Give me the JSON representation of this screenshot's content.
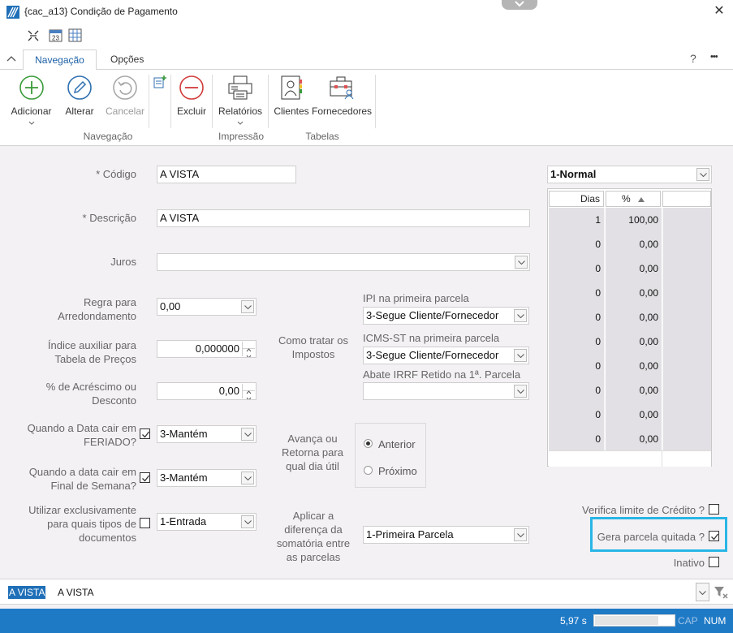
{
  "window": {
    "title": "{cac_a13}  Condição de Pagamento",
    "close_glyph": "✕"
  },
  "tabs": [
    {
      "label": "Navegação",
      "active": true
    },
    {
      "label": "Opções",
      "active": false
    }
  ],
  "tab_right": {
    "help": "?",
    "more": "•••"
  },
  "ribbon": {
    "buttons": {
      "adicionar": "Adicionar",
      "alterar": "Alterar",
      "cancelar": "Cancelar",
      "excluir": "Excluir",
      "relatorios": "Relatórios",
      "clientes": "Clientes",
      "fornecedores": "Fornecedores"
    },
    "groups": {
      "navegacao": "Navegação",
      "impressao": "Impressão",
      "tabelas": "Tabelas"
    }
  },
  "form": {
    "codigo": {
      "label": "* Código",
      "value": "A VISTA"
    },
    "descricao": {
      "label": "* Descrição",
      "value": "A VISTA"
    },
    "juros": {
      "label": "Juros",
      "value": ""
    },
    "regra": {
      "label": "Regra para\nArredondamento",
      "value": "0,00"
    },
    "indice": {
      "label": "Índice auxiliar para\nTabela de Preços",
      "value": "0,000000"
    },
    "acrescimo": {
      "label": "% de Acréscimo ou\nDesconto",
      "value": "0,00"
    },
    "feriado": {
      "label": "Quando a Data cair em\nFERIADO?",
      "checked": true,
      "value": "3-Mantém"
    },
    "fim_semana": {
      "label": "Quando a data cair em\nFinal de Semana?",
      "checked": true,
      "value": "3-Mantém"
    },
    "tipos_doc": {
      "label": "Utilizar exclusivamente\npara quais tipos de\ndocumentos",
      "checked": false,
      "value": "1-Entrada"
    },
    "impostos": {
      "label": "Como tratar os\nImpostos"
    },
    "ipi": {
      "label": "IPI na primeira parcela",
      "value": "3-Segue Cliente/Fornecedor"
    },
    "icms": {
      "label": "ICMS-ST na primeira parcela",
      "value": "3-Segue Cliente/Fornecedor"
    },
    "irrf": {
      "label": "Abate IRRF Retido na 1ª. Parcela",
      "value": ""
    },
    "avanca": {
      "label": "Avança ou\nRetorna para\nqual dia útil",
      "options": [
        {
          "label": "Anterior",
          "selected": true
        },
        {
          "label": "Próximo",
          "selected": false
        }
      ]
    },
    "diferenca": {
      "label": "Aplicar a\ndiferença da\nsomatória entre\nas parcelas",
      "value": "1-Primeira Parcela"
    },
    "verifica_credito": {
      "label": "Verifica limite de Crédito ?",
      "checked": false
    },
    "gera_parcela": {
      "label": "Gera parcela quitada ?",
      "checked": true
    },
    "inativo": {
      "label": "Inativo",
      "checked": false
    }
  },
  "grid": {
    "type_select": "1-Normal",
    "headers": {
      "dias": "Dias",
      "pct": "%"
    },
    "rows": [
      {
        "dias": "1",
        "pct": "100,00"
      },
      {
        "dias": "0",
        "pct": "0,00"
      },
      {
        "dias": "0",
        "pct": "0,00"
      },
      {
        "dias": "0",
        "pct": "0,00"
      },
      {
        "dias": "0",
        "pct": "0,00"
      },
      {
        "dias": "0",
        "pct": "0,00"
      },
      {
        "dias": "0",
        "pct": "0,00"
      },
      {
        "dias": "0",
        "pct": "0,00"
      },
      {
        "dias": "0",
        "pct": "0,00"
      },
      {
        "dias": "0",
        "pct": "0,00"
      }
    ]
  },
  "bottom": {
    "code": "A VISTA",
    "desc": "A VISTA"
  },
  "status": {
    "time": "5,97 s",
    "cap": "CAP",
    "num": "NUM",
    "progress": 0.8
  },
  "colors": {
    "accent": "#1f7ac6",
    "highlight": "#29b6e6",
    "grid_bg": "#e2e0e4"
  },
  "icons": [
    "app-grid-icon",
    "collapse-icon",
    "calendar-icon",
    "table-icon",
    "chevron-down-icon",
    "plus-circle-icon",
    "pencil-icon",
    "undo-icon",
    "new-doc-icon",
    "minus-circle-icon",
    "printer-icon",
    "client-icon",
    "supplier-icon",
    "filter-icon"
  ]
}
